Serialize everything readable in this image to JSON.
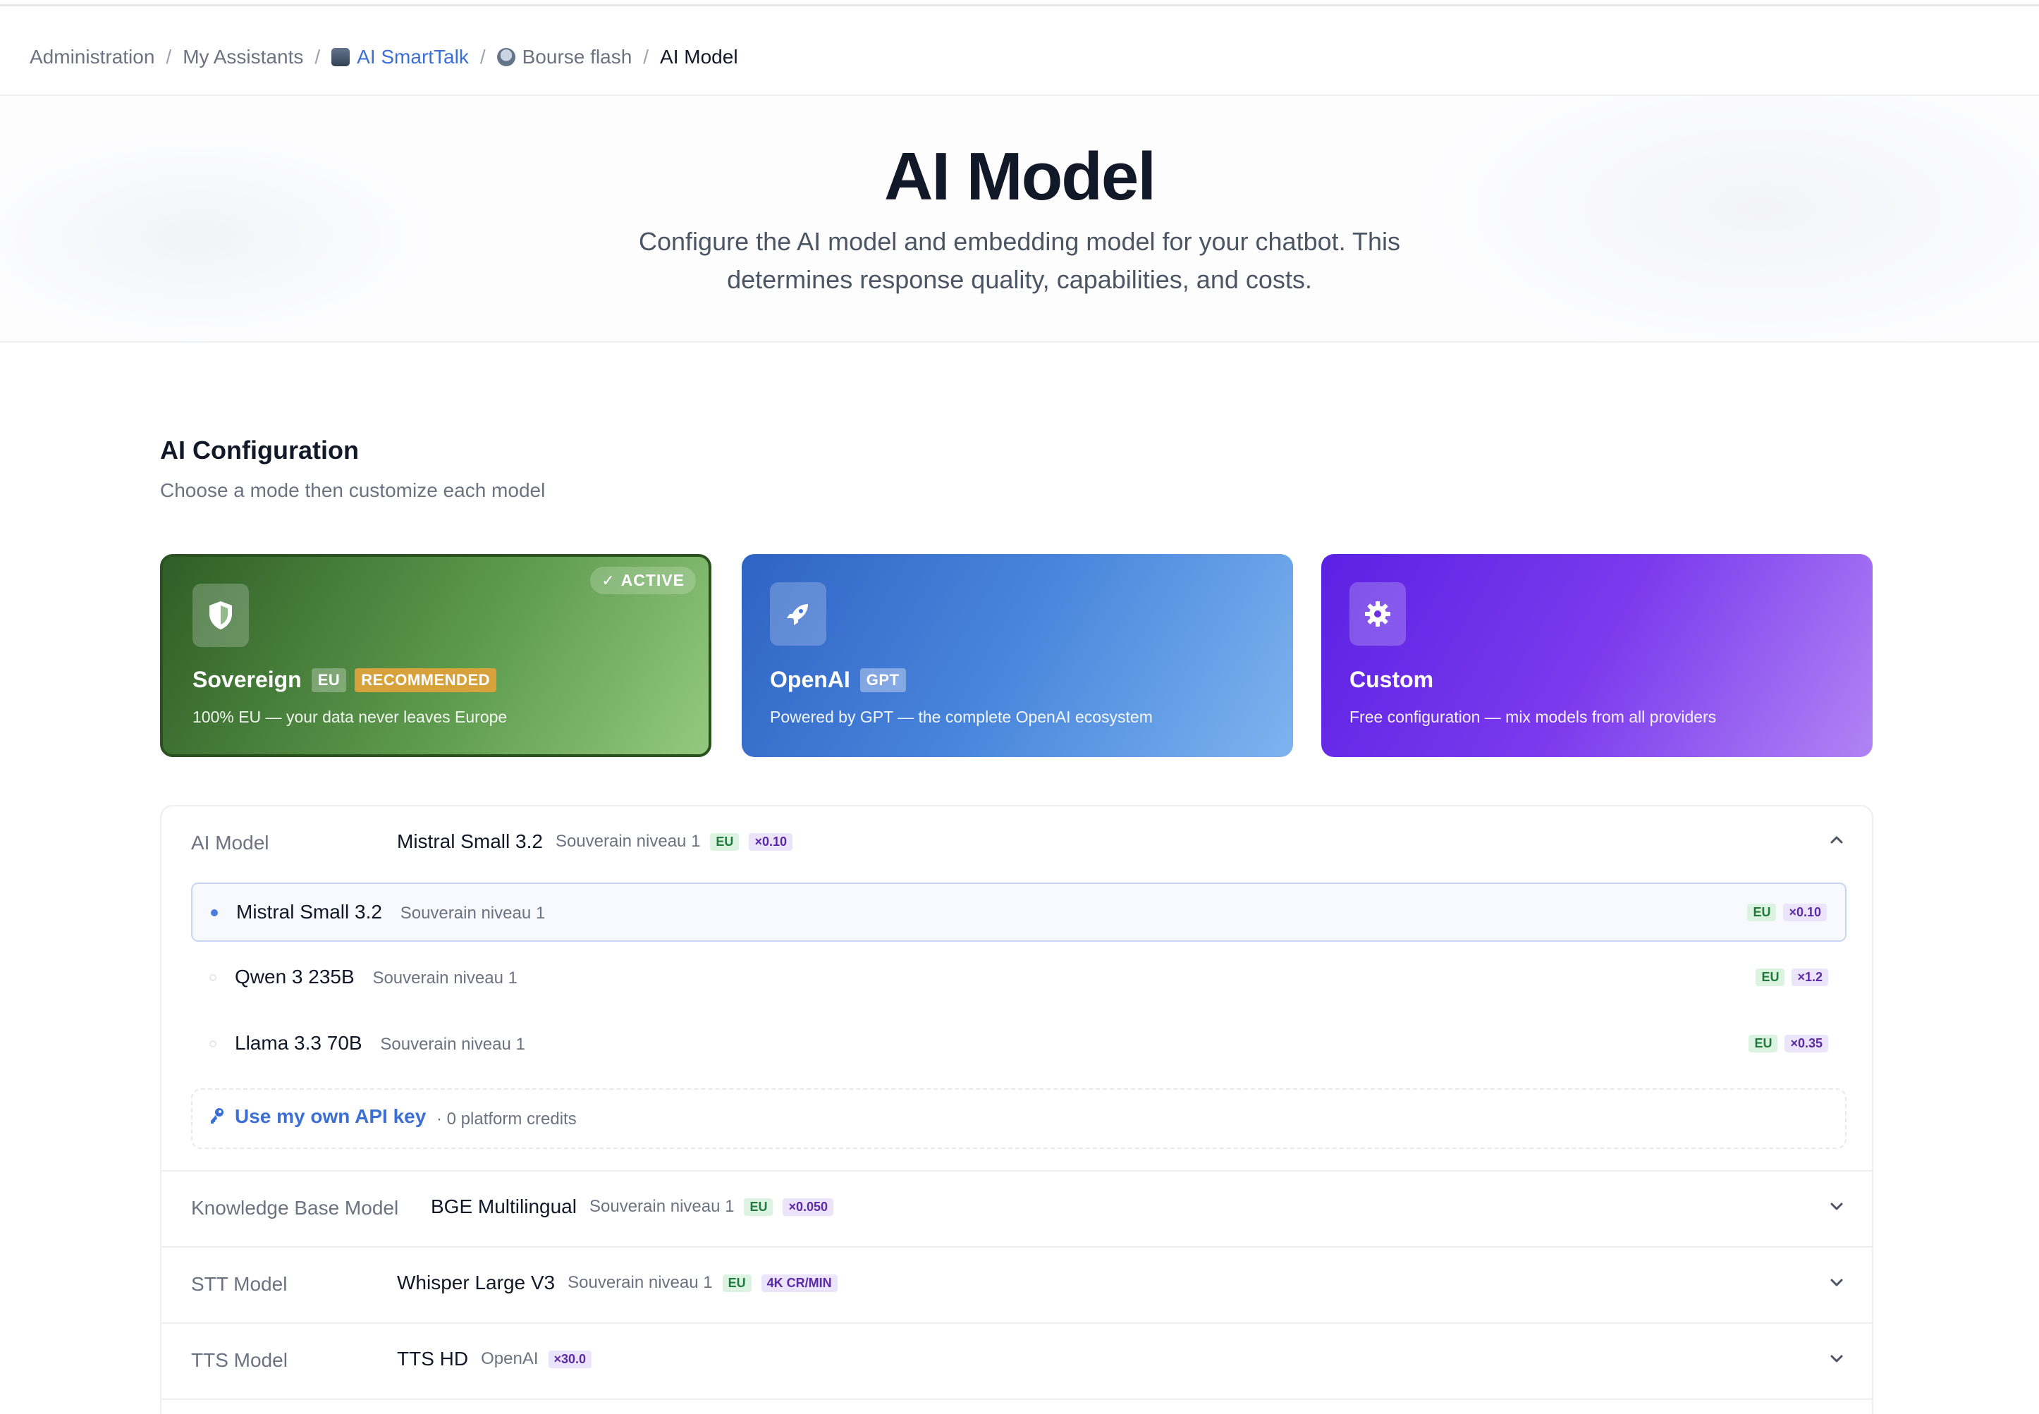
{
  "breadcrumb": {
    "items": [
      {
        "label": "Administration"
      },
      {
        "label": "My Assistants"
      },
      {
        "label": "AI SmartTalk"
      },
      {
        "label": "Bourse flash"
      },
      {
        "label": "AI Model"
      }
    ],
    "separator": "/"
  },
  "hero": {
    "title": "AI Model",
    "subtitle": "Configure the AI model and embedding model for your chatbot. This determines response quality, capabilities, and costs."
  },
  "config": {
    "title": "AI Configuration",
    "subtitle": "Choose a mode then customize each model"
  },
  "modes": [
    {
      "name": "Sovereign",
      "tag": "EU",
      "extra_tag": "RECOMMENDED",
      "description": "100% EU — your data never leaves Europe",
      "active_label": "ACTIVE",
      "icon": "shield-icon",
      "color": "#4a8a3c"
    },
    {
      "name": "OpenAI",
      "tag": "GPT",
      "description": "Powered by GPT — the complete OpenAI ecosystem",
      "icon": "rocket-icon",
      "color": "#3b74d6"
    },
    {
      "name": "Custom",
      "description": "Free configuration — mix models from all providers",
      "icon": "gear-icon",
      "color": "#6d2ee6"
    }
  ],
  "models": {
    "ai_model": {
      "label": "AI Model",
      "selected": {
        "name": "Mistral Small 3.2",
        "level": "Souverain niveau 1",
        "region": "EU",
        "multiplier": "×0.10"
      },
      "options": [
        {
          "name": "Mistral Small 3.2",
          "level": "Souverain niveau 1",
          "region": "EU",
          "multiplier": "×0.10",
          "selected": true
        },
        {
          "name": "Qwen 3 235B",
          "level": "Souverain niveau 1",
          "region": "EU",
          "multiplier": "×1.2",
          "selected": false
        },
        {
          "name": "Llama 3.3 70B",
          "level": "Souverain niveau 1",
          "region": "EU",
          "multiplier": "×0.35",
          "selected": false
        }
      ],
      "own_key_label": "Use my own API key",
      "own_key_credits": "· 0 platform credits"
    },
    "kb_model": {
      "label": "Knowledge Base Model",
      "name": "BGE Multilingual",
      "level": "Souverain niveau 1",
      "region": "EU",
      "multiplier": "×0.050"
    },
    "stt_model": {
      "label": "STT Model",
      "name": "Whisper Large V3",
      "level": "Souverain niveau 1",
      "region": "EU",
      "multiplier": "4K CR/MIN"
    },
    "tts_model": {
      "label": "TTS Model",
      "name": "TTS HD",
      "level": "OpenAI",
      "multiplier": "×30.0"
    }
  }
}
